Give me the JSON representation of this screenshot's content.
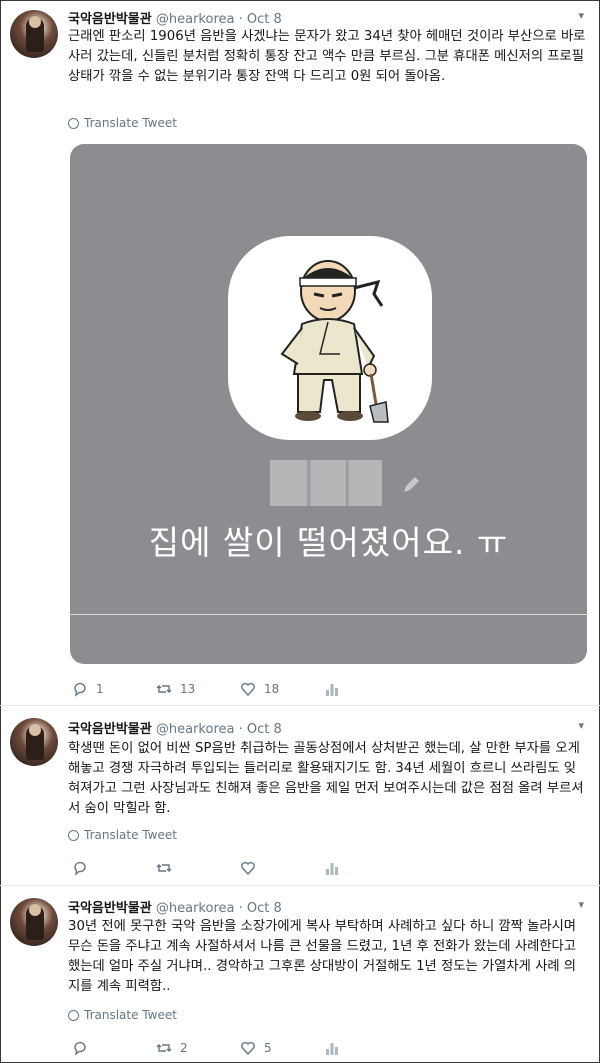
{
  "tweets": [
    {
      "name": "국악음반박물관",
      "handle": "@hearkorea",
      "dot": "·",
      "date": "Oct 8",
      "text": "근래엔 판소리 1906년 음반을 사겠냐는 문자가 왔고 34년 찾아 헤매던 것이라 부산으로 바로 사러 갔는데, 신들린 분처럼 정확히 통장 잔고 액수 만큼 부르심. 그분 휴대폰 메신저의 프로필 상태가 깎을 수 없는 분위기라 통장 잔액 다 드리고 0원 되어 돌아옴.",
      "translate": "Translate Tweet",
      "media_text": "집에 쌀이 떨어졌어요. ㅠ",
      "replies": "1",
      "retweets": "13",
      "likes": "18"
    },
    {
      "name": "국악음반박물관",
      "handle": "@hearkorea",
      "dot": "·",
      "date": "Oct 8",
      "text": "학생땐 돈이 없어 비싼 SP음반 취급하는 골동상점에서 상처받곤 했는데, 살 만한 부자를 오게 해놓고 경쟁 자극하려 투입되는 들러리로 활용돼지기도 함. 34년 세월이 흐르니 쓰라림도 잊혀져가고 그런 사장님과도 친해져 좋은 음반을 제일 먼저 보여주시는데 값은 점점 올려 부르셔서 숨이 막힐라 함.",
      "translate": "Translate Tweet",
      "replies": "",
      "retweets": "",
      "likes": ""
    },
    {
      "name": "국악음반박물관",
      "handle": "@hearkorea",
      "dot": "·",
      "date": "Oct 8",
      "text": "30년 전에 못구한 국악 음반을 소장가에게 복사 부탁하며 사례하고 싶다 하니 깜짝 놀라시며 무슨 돈을 주냐고 계속 사절하셔서 나름 큰 선물을 드렸고, 1년 후 전화가 왔는데 사례한다고 했는데 얼마 주실 거냐며.. 경악하고 그후론 상대방이 거절해도 1년 정도는 가열차게 사례 의지를 계속 피력함..",
      "translate": "Translate Tweet",
      "replies": "",
      "retweets": "2",
      "likes": "5"
    }
  ],
  "icons": {
    "reply": "reply-icon",
    "retweet": "retweet-icon",
    "like": "heart-icon",
    "analytics": "analytics-icon",
    "caret": "chevron-down-icon",
    "globe": "globe-icon"
  },
  "colors": {
    "muted": "#657786",
    "text": "#14171a",
    "media_bg": "#8b8d91",
    "separator": "#e1e8ed"
  }
}
